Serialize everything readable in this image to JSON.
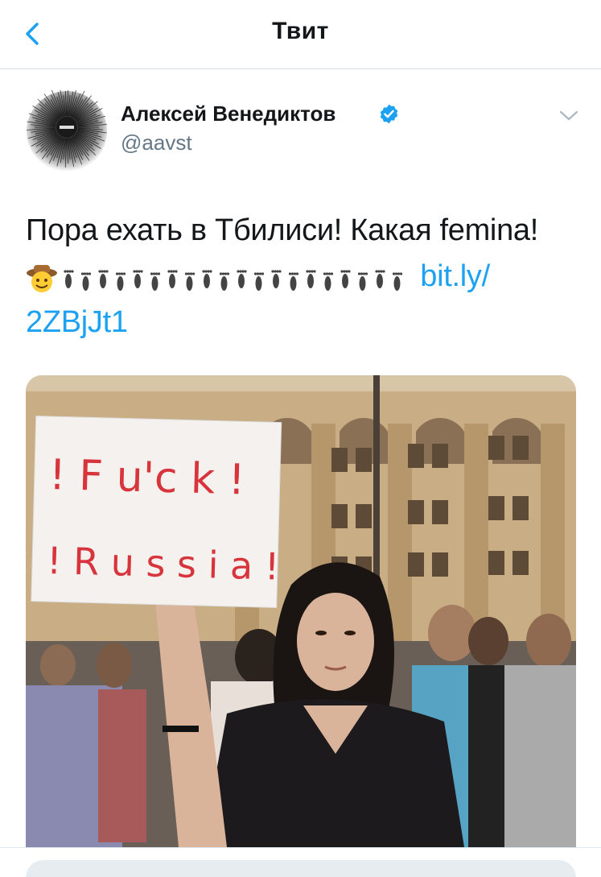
{
  "header": {
    "title": "Твит"
  },
  "author": {
    "name": "Алексей Венедиктов",
    "handle": "@aavst",
    "verified": true
  },
  "tweet": {
    "text": "Пора ехать в Тбилиси! Какая femina!",
    "emoji_sequence": "🤠👣👣👣👣👣👣👣👣👣👣👣👣👣👣👣👣👣👣👣👣",
    "link_part1": "bit.ly/",
    "link_part2": "2ZBjJt1"
  },
  "media": {
    "sign_line1": "! F u'c k !",
    "sign_line2": "! R u s s i a !"
  },
  "colors": {
    "link": "#1da1f2",
    "handle": "#657786",
    "divider": "#e1e8ed",
    "verified": "#1da1f2"
  }
}
